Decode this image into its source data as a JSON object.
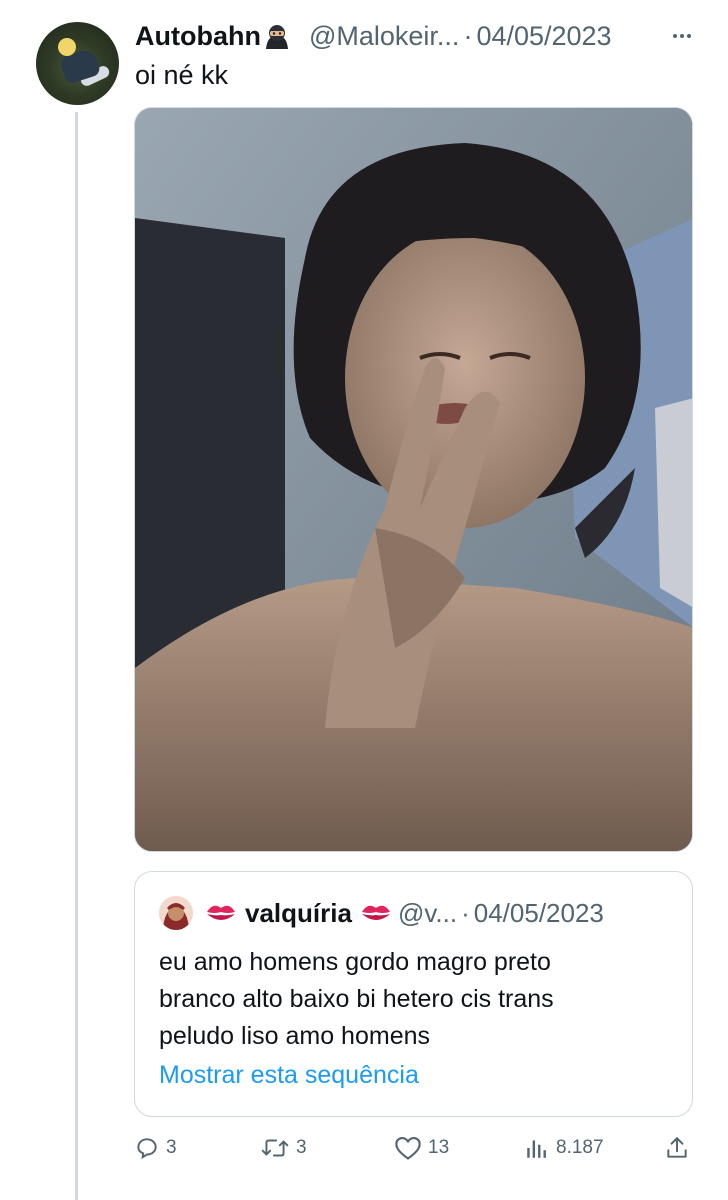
{
  "tweet": {
    "display_name": "Autobahn",
    "name_emoji": "ninja-emoji",
    "handle": "@Malokeir...",
    "separator": "·",
    "date": "04/05/2023",
    "text": "oi né kk",
    "has_photo": true
  },
  "quoted_tweet": {
    "display_name": "valquíria",
    "name_emoji": "kiss-mark-emoji",
    "handle": "@v...",
    "separator": "·",
    "date": "04/05/2023",
    "text_lines": [
      "eu amo homens gordo magro preto",
      "branco alto baixo bi hetero cis trans",
      "peludo liso amo homens"
    ],
    "show_thread_label": "Mostrar esta sequência"
  },
  "actions": {
    "replies": "3",
    "retweets": "3",
    "likes": "13",
    "views": "8.187"
  },
  "colors": {
    "text": "#0f1419",
    "secondary": "#536471",
    "link": "#1d9bf0",
    "border": "#cfd9de"
  },
  "icons": [
    "more-icon",
    "reply-icon",
    "retweet-icon",
    "like-icon",
    "views-icon",
    "share-icon"
  ]
}
